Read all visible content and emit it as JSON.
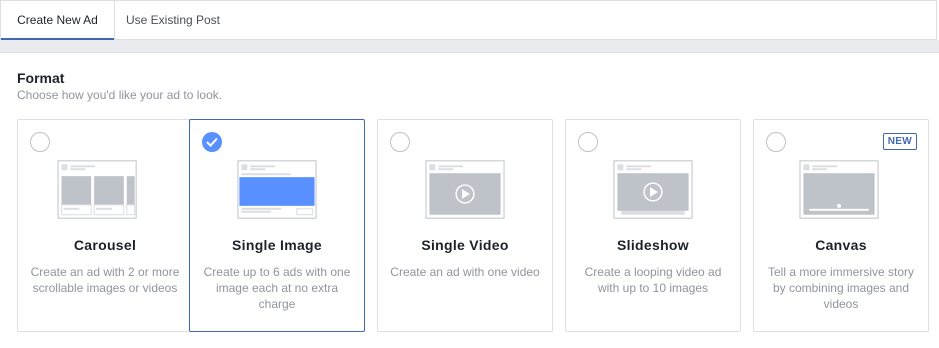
{
  "tabs": {
    "create_new_ad": "Create New Ad",
    "use_existing_post": "Use Existing Post"
  },
  "section": {
    "title": "Format",
    "subtitle": "Choose how you'd like your ad to look."
  },
  "cards": [
    {
      "title": "Carousel",
      "description": "Create an ad with 2 or more scrollable images or videos",
      "selected": false,
      "icon": "carousel-icon"
    },
    {
      "title": "Single Image",
      "description": "Create up to 6 ads with one image each at no extra charge",
      "selected": true,
      "icon": "single-image-icon"
    },
    {
      "title": "Single Video",
      "description": "Create an ad with one video",
      "selected": false,
      "icon": "single-video-icon"
    },
    {
      "title": "Slideshow",
      "description": "Create a looping video ad with up to 10 images",
      "selected": false,
      "icon": "slideshow-icon"
    },
    {
      "title": "Canvas",
      "description": "Tell a more immersive story by combining images and videos",
      "selected": false,
      "badge": "NEW",
      "icon": "canvas-icon"
    }
  ],
  "colors": {
    "accent": "#4267b2",
    "check": "#5890ff",
    "muted_text": "#90949c",
    "border": "#dddfe2"
  }
}
